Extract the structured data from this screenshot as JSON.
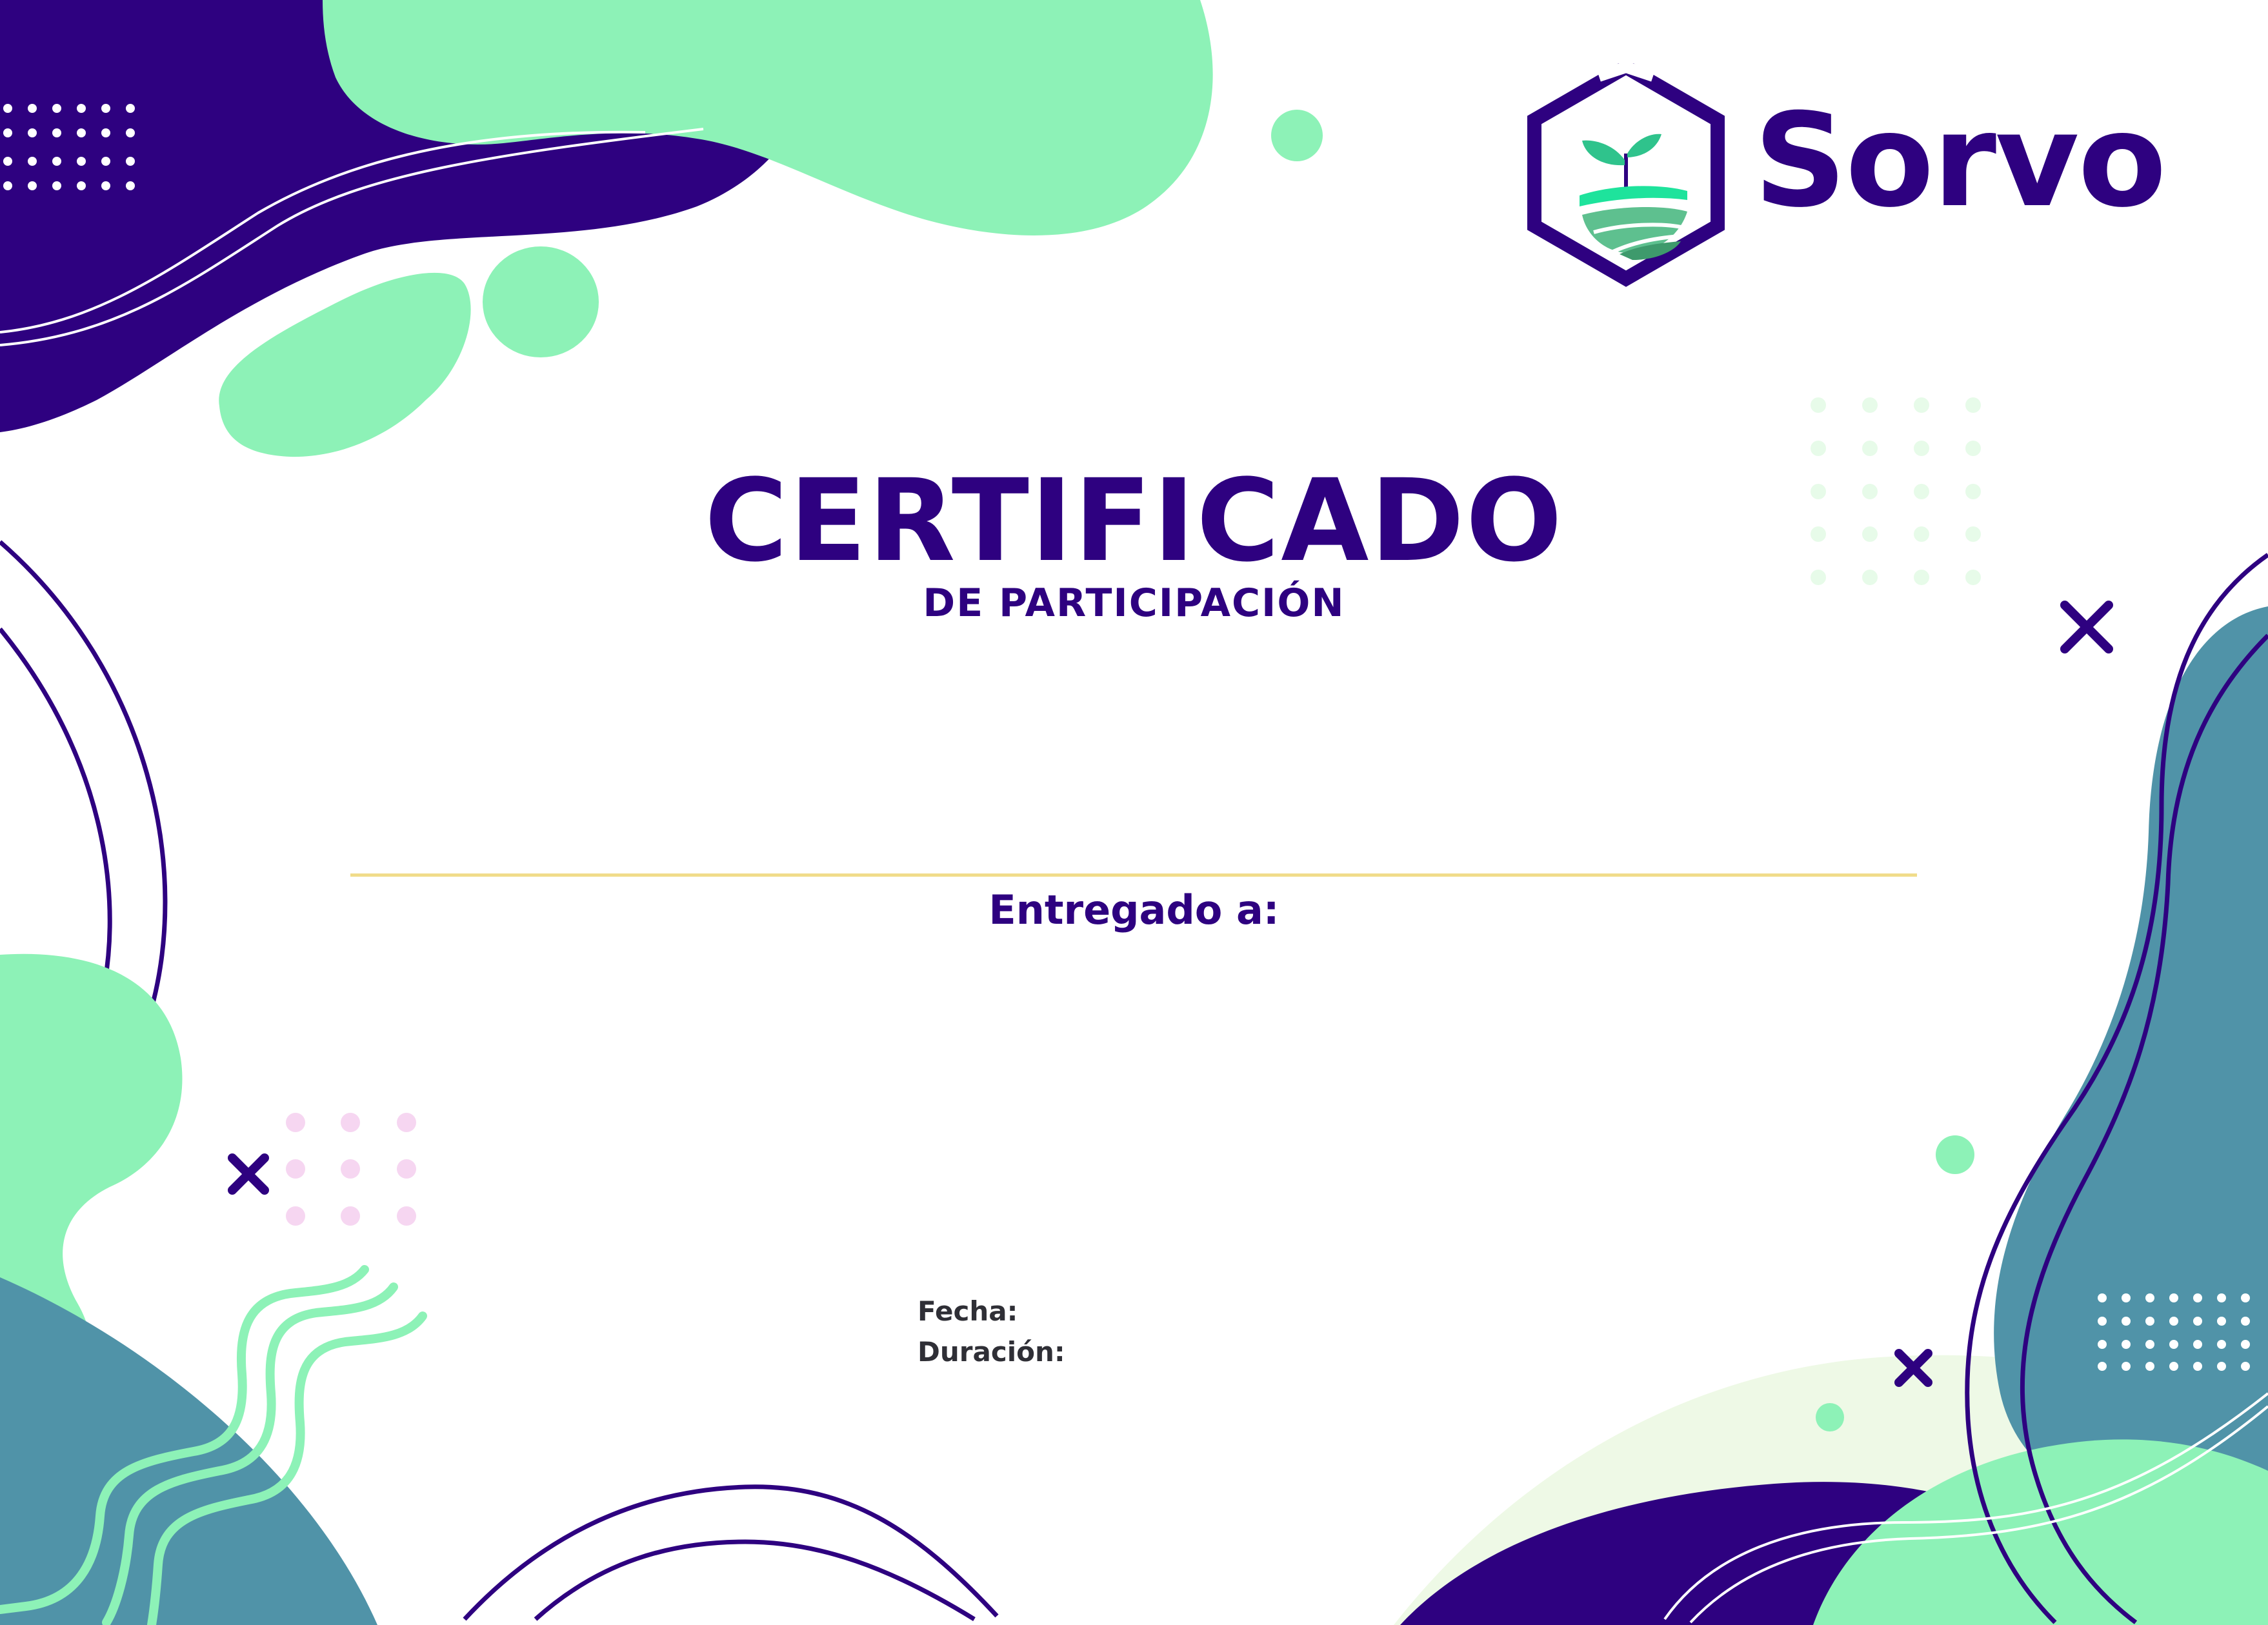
{
  "certificate": {
    "title": "CERTIFICADO",
    "subtitle": "DE PARTICIPACIÓN",
    "presented_to_label": "Entregado a:",
    "date_label": "Fecha:",
    "duration_label": "Duración:"
  },
  "brand": {
    "name": "Sorvo",
    "logo_icon": "hexagon-sprout-field-logo"
  },
  "colors": {
    "primary_purple": "#2e0180",
    "mint_green": "#8df2b7",
    "teal_blue": "#5093a8",
    "light_green": "#eef9e6",
    "gold_line": "#f1dc8a",
    "pink_dots": "#f6d6f1",
    "text_dark": "#2f2f36"
  }
}
